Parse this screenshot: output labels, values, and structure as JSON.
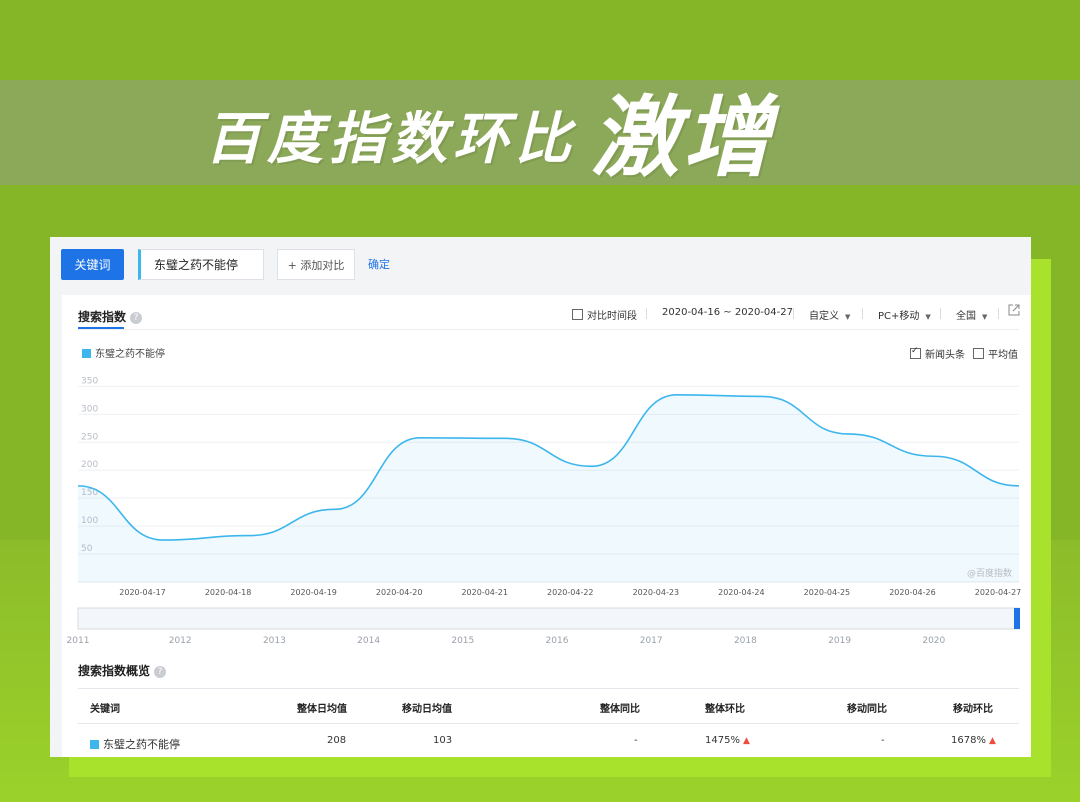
{
  "banner": {
    "title": "百度指数环比",
    "highlight": "激增"
  },
  "toolbar": {
    "keyword_button": "关键词",
    "keyword_value": "东璧之药不能停",
    "add_compare": "+ 添加对比",
    "confirm": "确定"
  },
  "panel": {
    "title": "搜索指数",
    "compare_period": "对比时间段",
    "date_range": "2020-04-16 ~ 2020-04-27",
    "custom": "自定义",
    "device": "PC+移动",
    "region": "全国",
    "legend": "东璧之药不能停",
    "news_headlines": "新闻头条",
    "news_headlines_checked": true,
    "average": "平均值",
    "average_checked": false,
    "watermark": "@百度指数",
    "icons": [
      "help-icon",
      "external-link-icon",
      "caret-down-icon",
      "checkbox-icon",
      "arrow-up-icon"
    ]
  },
  "chart_data": {
    "type": "area",
    "series": [
      {
        "values": [
          172,
          75,
          83,
          130,
          258,
          257,
          207,
          335,
          332,
          265,
          225,
          172
        ]
      }
    ],
    "y_ticks": [
      50,
      100,
      150,
      200,
      250,
      300,
      350
    ],
    "ylim": [
      0,
      365
    ],
    "x_ticks": [
      "2020-04-17",
      "2020-04-18",
      "2020-04-19",
      "2020-04-20",
      "2020-04-21",
      "2020-04-22",
      "2020-04-23",
      "2020-04-24",
      "2020-04-25",
      "2020-04-26",
      "2020-04-27"
    ],
    "color": "#3cb6ec",
    "grid": true
  },
  "timeline": {
    "years": [
      "2011",
      "2012",
      "2013",
      "2014",
      "2015",
      "2016",
      "2017",
      "2018",
      "2019",
      "2020"
    ]
  },
  "overview": {
    "title": "搜索指数概览",
    "headers": [
      "关键词",
      "整体日均值",
      "移动日均值",
      "整体同比",
      "整体环比",
      "移动同比",
      "移动环比"
    ],
    "row": {
      "keyword": "东璧之药不能停",
      "overall_avg": "208",
      "mobile_avg": "103",
      "overall_yoy": "-",
      "overall_mom": "1475%",
      "mobile_yoy": "-",
      "mobile_mom": "1678%"
    }
  },
  "colors": {
    "accent": "#1e73e6",
    "series": "#3cb6ec",
    "up_arrow": "#f04b3a",
    "background": "#85b628"
  }
}
